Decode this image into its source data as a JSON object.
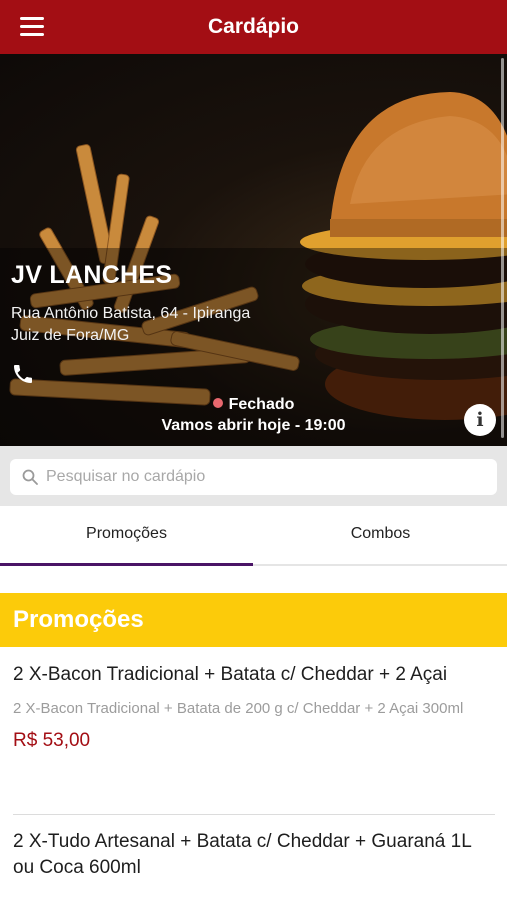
{
  "header": {
    "title": "Cardápio",
    "menu_icon": "hamburger-menu-icon"
  },
  "store": {
    "name": "JV LANCHES",
    "address_line1": "Rua Antônio Batista, 64 - Ipiranga",
    "address_line2": "Juiz de Fora/MG",
    "phone_icon": "phone-icon",
    "status": "Fechado",
    "status_color": "#e8686e",
    "opens": "Vamos abrir hoje - 19:00",
    "info_icon": "info-icon",
    "info_glyph": "i"
  },
  "search": {
    "placeholder": "Pesquisar no cardápio",
    "value": ""
  },
  "tabs": [
    {
      "label": "Promoções",
      "active": true
    },
    {
      "label": "Combos",
      "active": false
    }
  ],
  "section": {
    "title": "Promoções"
  },
  "items": [
    {
      "name": "2 X-Bacon Tradicional + Batata c/ Cheddar + 2 Açai",
      "description": "2 X-Bacon Tradicional + Batata de 200 g c/ Cheddar + 2 Açai 300ml",
      "price": "R$ 53,00"
    },
    {
      "name": "2 X-Tudo Artesanal + Batata c/ Cheddar + Guaraná 1L ou Coca 600ml",
      "description": "",
      "price": ""
    }
  ],
  "colors": {
    "brand": "#a30e14",
    "section": "#fccb0a",
    "tab_indicator": "#4a1466"
  }
}
